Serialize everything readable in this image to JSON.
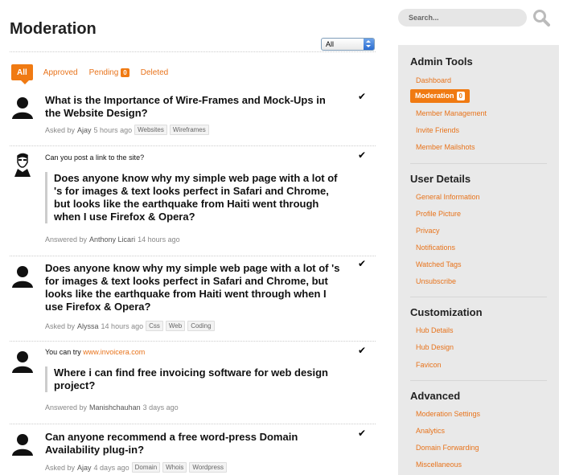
{
  "page": {
    "title": "Moderation"
  },
  "filter": {
    "selected": "All"
  },
  "tabs": [
    {
      "label": "All",
      "active": true
    },
    {
      "label": "Approved"
    },
    {
      "label": "Pending",
      "badge": "0"
    },
    {
      "label": "Deleted"
    }
  ],
  "items": [
    {
      "type": "question",
      "title_lines": [
        "What is the Importance of Wire-Frames and Mock-Ups in",
        "the Website Design?"
      ],
      "meta_prefix": "Asked by",
      "author": "Ajay",
      "time": "5 hours ago",
      "tags": [
        "Websites",
        "Wireframes"
      ]
    },
    {
      "type": "answer",
      "text": "Can you post a link to the site?",
      "quote_lines": [
        "Does anyone know why my simple web page with a lot of",
        "'s for images & text looks perfect in Safari and Chrome,",
        "but looks like the earthquake from Haiti went through",
        "when I use Firefox & Opera?"
      ],
      "meta_prefix": "Answered by",
      "author": "Anthony Licari",
      "time": "14 hours ago"
    },
    {
      "type": "question",
      "title_lines": [
        "Does anyone know why my simple web page with a lot of 's",
        "for images & text looks perfect in Safari and Chrome, but",
        "looks like the earthquake from Haiti went through when I",
        "use Firefox & Opera?"
      ],
      "meta_prefix": "Asked by",
      "author": "Alyssa",
      "time": "14 hours ago",
      "tags": [
        "Css",
        "Web",
        "Coding"
      ]
    },
    {
      "type": "answer",
      "text_prefix": "You can try",
      "link": "www.invoicera.com",
      "quote_lines": [
        "Where i can find free invoicing software for web design",
        "project?"
      ],
      "meta_prefix": "Answered by",
      "author": "Manishchauhan",
      "time": "3 days ago"
    },
    {
      "type": "question",
      "title_lines": [
        "Can anyone recommend a free word-press Domain",
        "Availability plug-in?"
      ],
      "meta_prefix": "Asked by",
      "author": "Ajay",
      "time": "4 days ago",
      "tags": [
        "Domain",
        "Whois",
        "Wordpress"
      ]
    }
  ],
  "search": {
    "placeholder": "Search..."
  },
  "sidebar": {
    "admin_tools": {
      "heading": "Admin Tools",
      "items": [
        "Dashboard",
        "Moderation",
        "Member Management",
        "Invite Friends",
        "Member Mailshots"
      ],
      "active_badge": "0"
    },
    "user_details": {
      "heading": "User Details",
      "items": [
        "General Information",
        "Profile Picture",
        "Privacy",
        "Notifications",
        "Watched Tags",
        "Unsubscribe"
      ]
    },
    "customization": {
      "heading": "Customization",
      "items": [
        "Hub Details",
        "Hub Design",
        "Favicon"
      ]
    },
    "advanced": {
      "heading": "Advanced",
      "items": [
        "Moderation Settings",
        "Analytics",
        "Domain Forwarding",
        "Miscellaneous"
      ]
    }
  },
  "colors": {
    "accent": "#f07a12",
    "link": "#e8731b",
    "sidebar_bg": "#e9e9e9"
  }
}
